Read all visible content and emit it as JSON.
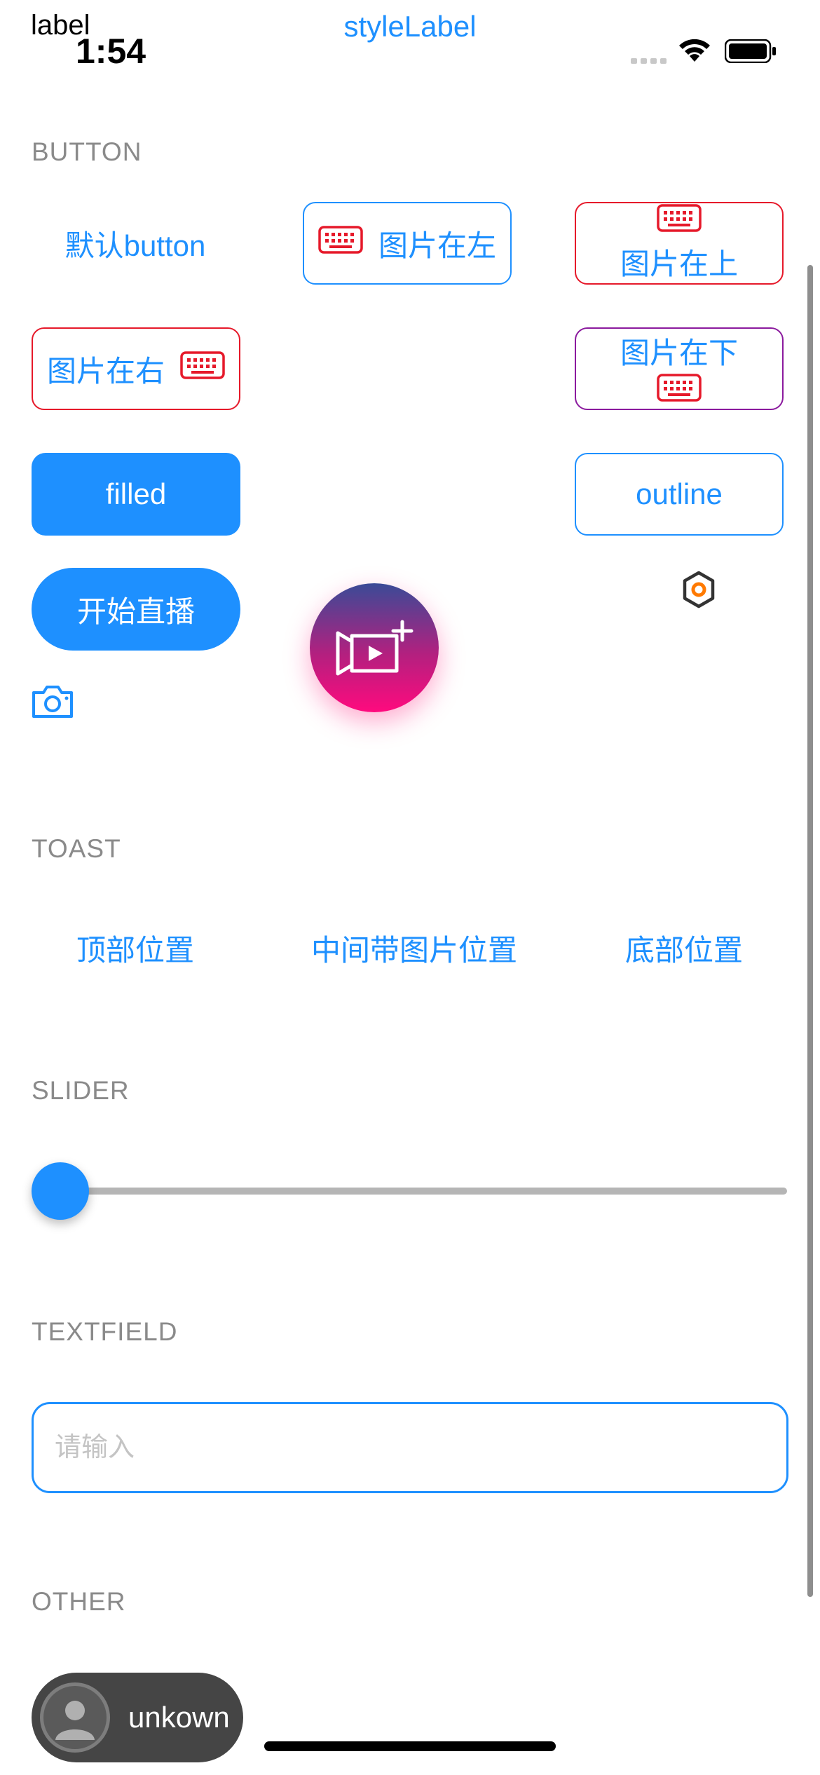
{
  "status_bar": {
    "time": "1:54",
    "top_left_label": "label"
  },
  "header": {
    "title": "styleLabel"
  },
  "sections": {
    "button": "BUTTON",
    "toast": "TOAST",
    "slider": "SLIDER",
    "textfield": "TEXTFIELD",
    "other": "OTHER"
  },
  "buttons": {
    "default": "默认button",
    "image_left": "图片在左",
    "image_top": "图片在上",
    "image_right": "图片在右",
    "image_bottom": "图片在下",
    "filled": "filled",
    "outline": "outline",
    "start_live": "开始直播"
  },
  "toast": {
    "top": "顶部位置",
    "middle_image": "中间带图片位置",
    "bottom": "底部位置"
  },
  "slider": {
    "value": 0.0
  },
  "textfield": {
    "placeholder": "请输入",
    "value": ""
  },
  "other": {
    "user_name": "unkown"
  },
  "colors": {
    "accent": "#1e90ff",
    "red_border": "#e6192a",
    "purple_border": "#8b1a9e",
    "fab_gradient_top": "#3a4b97",
    "fab_gradient_bottom": "#ff0a7e",
    "section_gray": "#8a8a8a"
  },
  "icons": [
    "keyboard-icon",
    "video-camera-add-icon",
    "camera-icon",
    "hexagon-settings-icon",
    "wifi-icon",
    "battery-icon",
    "cellular-icon",
    "user-avatar-icon"
  ]
}
